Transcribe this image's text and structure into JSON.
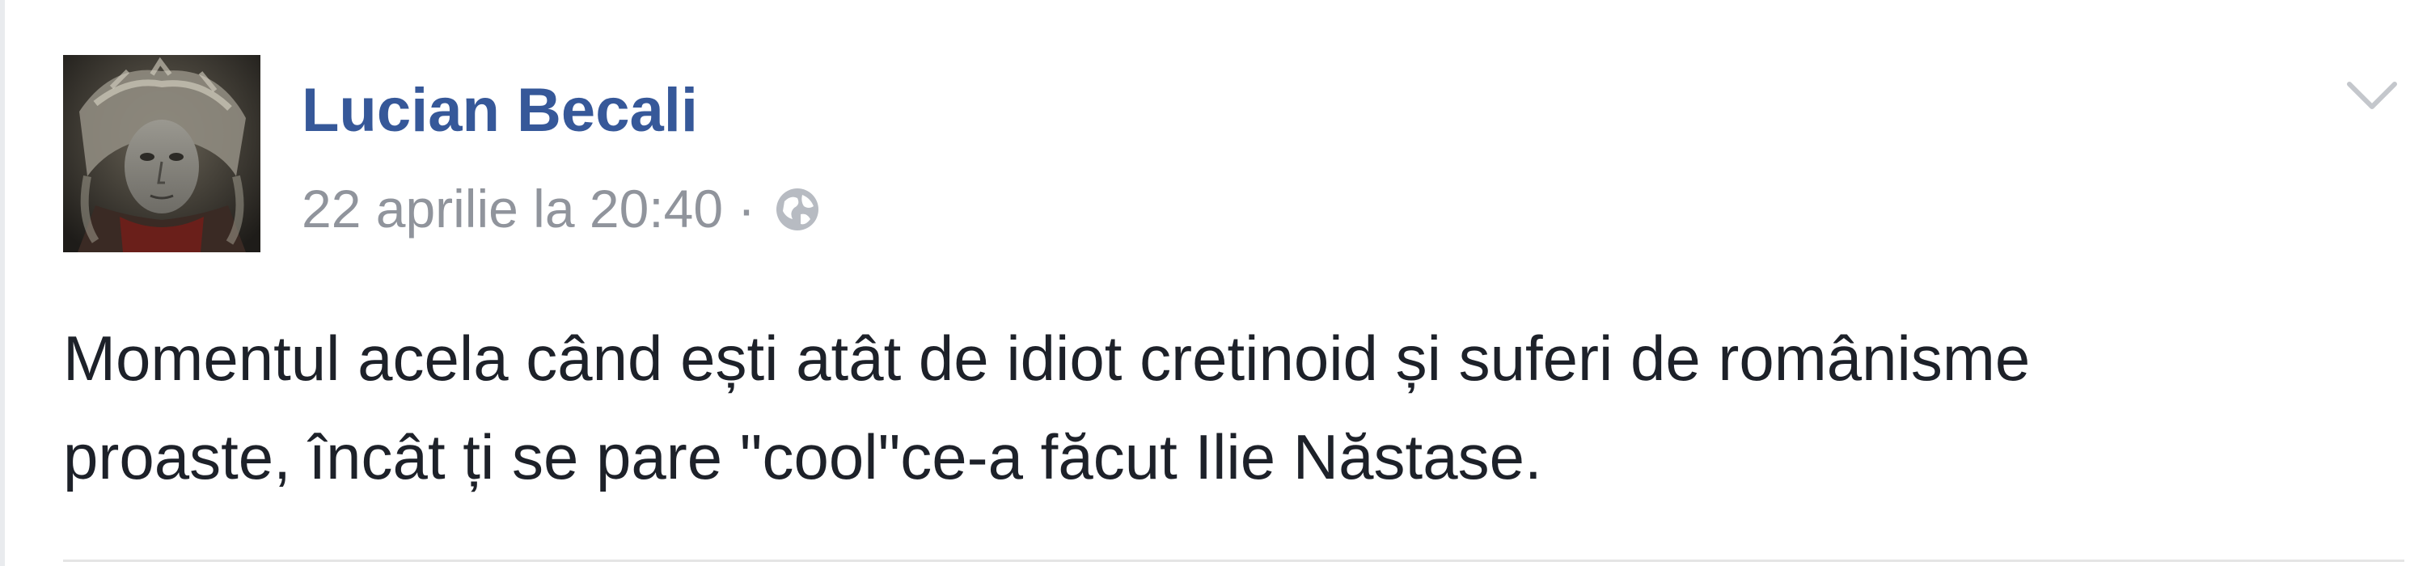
{
  "post": {
    "author": "Lucian Becali",
    "timestamp": "22 aprilie la 20:40",
    "meta_separator": "·",
    "privacy_icon": "globe-icon",
    "menu_icon": "chevron-down-icon",
    "text_lines": [
      "Momentul acela când ești atât de idiot cretinoid și suferi de românisme",
      "proaste, încât ți se pare \"cool\"ce-a făcut Ilie Năstase."
    ]
  },
  "colors": {
    "name": "#365899",
    "meta": "#90949c",
    "body_text": "#1d2129",
    "background": "#ffffff"
  }
}
